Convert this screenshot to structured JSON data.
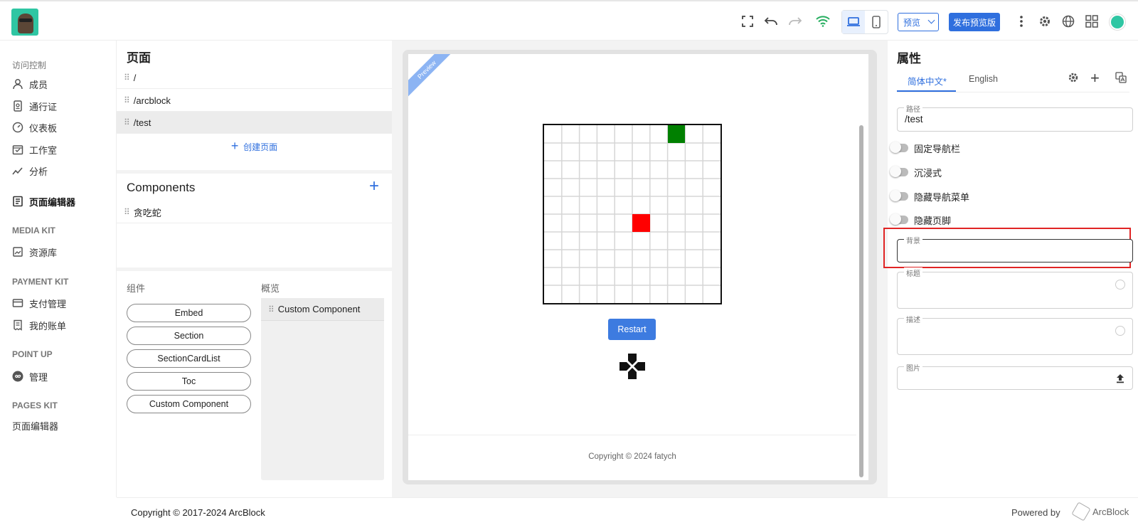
{
  "topbar": {
    "preview_label": "预览",
    "publish_label": "发布预览版"
  },
  "sidebar": {
    "sections": [
      {
        "title": "访问控制",
        "items": [
          "成员",
          "通行证",
          "仪表板",
          "工作室",
          "分析"
        ]
      },
      {
        "title": "",
        "items": [
          "页面编辑器"
        ]
      },
      {
        "title": "MEDIA KIT",
        "items": [
          "资源库"
        ]
      },
      {
        "title": "PAYMENT KIT",
        "items": [
          "支付管理",
          "我的账单"
        ]
      },
      {
        "title": "POINT UP",
        "items": [
          "管理"
        ]
      },
      {
        "title": "PAGES KIT",
        "items": [
          "页面编辑器"
        ]
      }
    ]
  },
  "pages": {
    "title": "页面",
    "rows": [
      "/",
      "/arcblock",
      "/test"
    ],
    "create_label": "创建页面"
  },
  "components": {
    "title": "Components",
    "rows": [
      "贪吃蛇"
    ]
  },
  "palette": {
    "components_label": "组件",
    "overview_label": "概览",
    "items": [
      "Embed",
      "Section",
      "SectionCardList",
      "Toc",
      "Custom Component"
    ],
    "overview_items": [
      "Custom Component"
    ]
  },
  "preview": {
    "ribbon": "Preview",
    "restart_label": "Restart",
    "copyright": "Copyright © 2024 fatych",
    "game": {
      "grid_cols": 10,
      "grid_rows": 10,
      "food": [
        5,
        5
      ],
      "snake": [
        [
          7,
          0
        ]
      ]
    }
  },
  "properties": {
    "title": "属性",
    "tabs": [
      "简体中文*",
      "English"
    ],
    "path_label": "路径",
    "path_value": "/test",
    "toggles": [
      "固定导航栏",
      "沉浸式",
      "隐藏导航菜单",
      "隐藏页脚"
    ],
    "background_label": "背景",
    "title_label": "标题",
    "description_label": "描述",
    "image_label": "图片"
  },
  "footer": {
    "copyright": "Copyright © 2017-2024  ArcBlock",
    "powered": "Powered by",
    "brand": "ArcBlock"
  }
}
